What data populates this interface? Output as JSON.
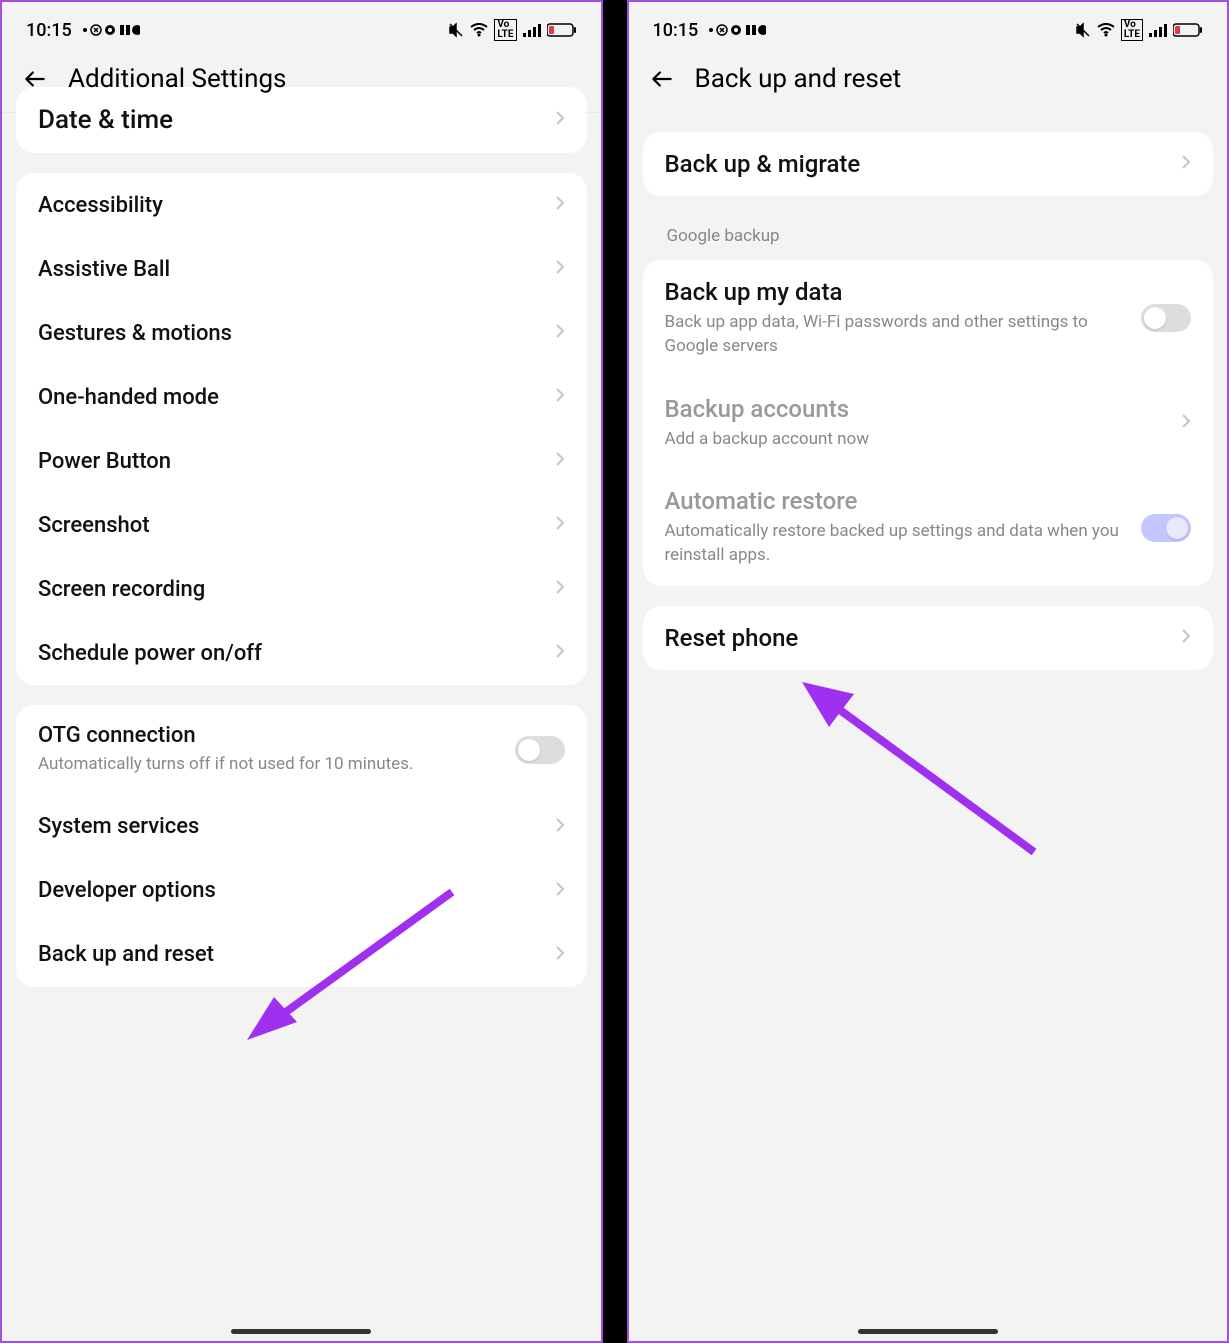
{
  "status": {
    "time": "10:15"
  },
  "screen1": {
    "title": "Additional Settings",
    "group0_cut": "Date & time",
    "group1": [
      "Accessibility",
      "Assistive Ball",
      "Gestures & motions",
      "One-handed mode",
      "Power Button",
      "Screenshot",
      "Screen recording",
      "Schedule power on/off"
    ],
    "otg": {
      "title": "OTG connection",
      "sub": "Automatically turns off if not used for 10 minutes."
    },
    "group2": [
      "System services",
      "Developer options",
      "Back up and reset"
    ]
  },
  "screen2": {
    "title": "Back up and reset",
    "backup_migrate": "Back up & migrate",
    "section_label": "Google backup",
    "backup_data": {
      "title": "Back up my data",
      "sub": "Back up app data, Wi-Fi passwords and other settings to Google servers"
    },
    "backup_accounts": {
      "title": "Backup accounts",
      "sub": "Add a backup account now"
    },
    "auto_restore": {
      "title": "Automatic restore",
      "sub": "Automatically restore backed up settings and data when you reinstall apps."
    },
    "reset_phone": "Reset phone"
  }
}
